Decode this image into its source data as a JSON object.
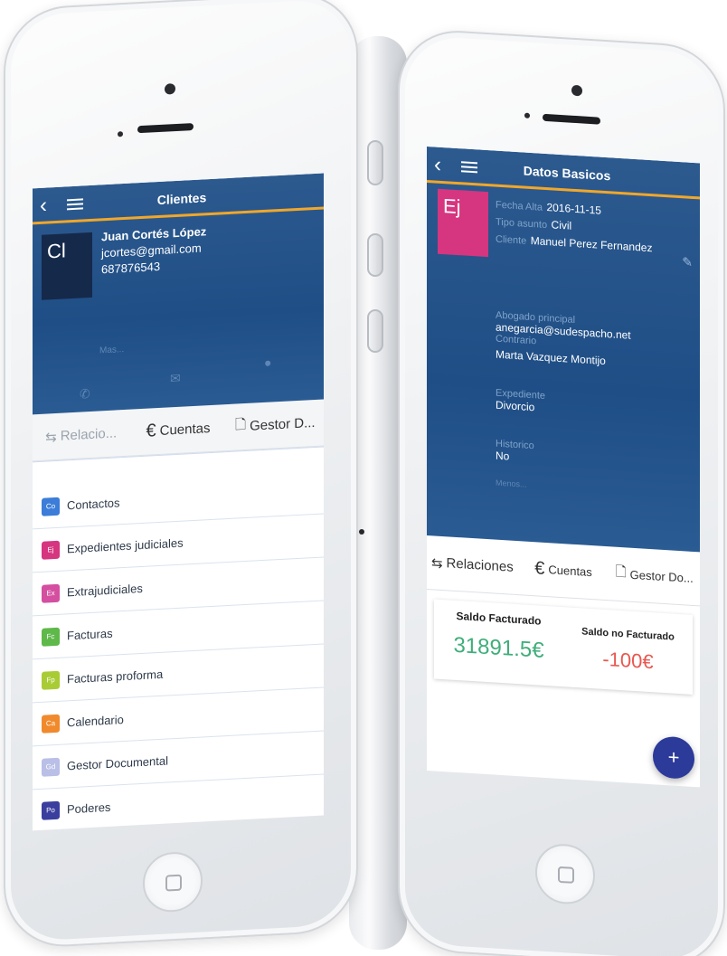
{
  "left_phone": {
    "app_title": "Clientes",
    "client": {
      "initials": "Cl",
      "name": "Juan Cortés López",
      "email": "jcortes@gmail.com",
      "phone": "687876543",
      "more": "Mas..."
    },
    "tabs": [
      {
        "icon": "⇆",
        "label": "Relacio..."
      },
      {
        "icon": "€",
        "label": "Cuentas"
      },
      {
        "icon": "🗋",
        "label": "Gestor D..."
      }
    ],
    "menu_items": [
      {
        "abbr": "Co",
        "label": "Contactos",
        "color": "#3b7dd8"
      },
      {
        "abbr": "Ej",
        "label": "Expedientes judiciales",
        "color": "#d6357f"
      },
      {
        "abbr": "Ex",
        "label": "Extrajudiciales",
        "color": "#d44fa0"
      },
      {
        "abbr": "Fc",
        "label": "Facturas",
        "color": "#5fb84a"
      },
      {
        "abbr": "Fp",
        "label": "Facturas proforma",
        "color": "#a9cc34"
      },
      {
        "abbr": "Ca",
        "label": "Calendario",
        "color": "#f08a2c"
      },
      {
        "abbr": "Gd",
        "label": "Gestor Documental",
        "color": "#b9bfe6"
      },
      {
        "abbr": "Po",
        "label": "Poderes",
        "color": "#3a3f9e"
      }
    ]
  },
  "right_phone": {
    "app_title": "Datos Basicos",
    "record": {
      "initials": "Ej",
      "fecha_alta_label": "Fecha Alta",
      "fecha_alta": "2016-11-15",
      "tipo_asunto_label": "Tipo asunto",
      "tipo_asunto": "Civil",
      "cliente_label": "Cliente",
      "cliente": "Manuel Perez Fernandez",
      "abogado_label": "Abogado principal",
      "abogado": "anegarcia@sudespacho.net",
      "contrario_label": "Contrario",
      "contrario": "Marta Vazquez Montijo",
      "expediente_label": "Expediente",
      "expediente": "Divorcio",
      "historico_label": "Historico",
      "historico": "No",
      "more": "Menos..."
    },
    "tabs": [
      {
        "icon": "⇆",
        "label": "Relaciones"
      },
      {
        "icon": "€",
        "label": "Cuentas"
      },
      {
        "icon": "🗋",
        "label": "Gestor Do..."
      }
    ],
    "balances": {
      "facturado_label": "Saldo Facturado",
      "facturado_value": "31891.5€",
      "no_facturado_label": "Saldo no Facturado",
      "no_facturado_value": "-100€"
    },
    "fab_label": "+"
  },
  "colors": {
    "header_blue": "#1f4e86",
    "accent_orange": "#f0a72a",
    "positive_green": "#3fae7a",
    "negative_red": "#e8574f",
    "fab_indigo": "#2c3a9a",
    "avatar_navy": "#15294a",
    "record_pink": "#d6357f"
  }
}
